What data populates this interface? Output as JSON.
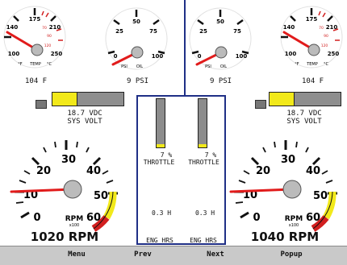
{
  "colors": {
    "needle": "#e11b1b",
    "yellow": "#f2e91a",
    "red": "#d21f1f",
    "navy": "#1f2f86",
    "gray": "#8c8c8c"
  },
  "temp_left": {
    "value": "104 F",
    "unit_f": "°F",
    "unit_c": "°C",
    "label": "TEMP",
    "ticks_outer": [
      "175",
      "210",
      "140",
      "250",
      "100"
    ],
    "ticks_inner": [
      "70",
      "90",
      "120"
    ]
  },
  "temp_right": {
    "value": "104 F",
    "unit_f": "°F",
    "unit_c": "°C",
    "label": "TEMP",
    "ticks_outer": [
      "175",
      "210",
      "140",
      "250",
      "100"
    ],
    "ticks_inner": [
      "70",
      "90",
      "120"
    ]
  },
  "oil_left": {
    "value": "9 PSI",
    "label": "OIL",
    "unit": "PSI",
    "ticks": [
      "50",
      "25",
      "75",
      "0",
      "100"
    ]
  },
  "oil_right": {
    "value": "9 PSI",
    "label": "OIL",
    "unit": "PSI",
    "ticks": [
      "50",
      "25",
      "75",
      "0",
      "100"
    ]
  },
  "volt_left": {
    "value": "18.7 VDC",
    "label": "SYS VOLT",
    "fill_fraction": 0.6
  },
  "volt_right": {
    "value": "18.7 VDC",
    "label": "SYS VOLT",
    "fill_fraction": 0.6
  },
  "throttle_left": {
    "value": "7 %",
    "label": "THROTTLE",
    "fill_fraction": 0.07
  },
  "throttle_right": {
    "value": "7 %",
    "label": "THROTTLE",
    "fill_fraction": 0.07
  },
  "hours_left": {
    "value": "0.3 H",
    "label": "ENG HRS"
  },
  "hours_right": {
    "value": "0.3 H",
    "label": "ENG HRS"
  },
  "rpm_left": {
    "value": "1020 RPM",
    "label": "RPM",
    "sub": "x100",
    "ticks": [
      "30",
      "20",
      "40",
      "10",
      "50",
      "0",
      "60"
    ]
  },
  "rpm_right": {
    "value": "1040 RPM",
    "label": "RPM",
    "sub": "x100",
    "ticks": [
      "30",
      "20",
      "40",
      "10",
      "50",
      "0",
      "60"
    ]
  },
  "footer": {
    "menu": "Menu",
    "prev": "Prev",
    "next": "Next",
    "popup": "Popup"
  }
}
